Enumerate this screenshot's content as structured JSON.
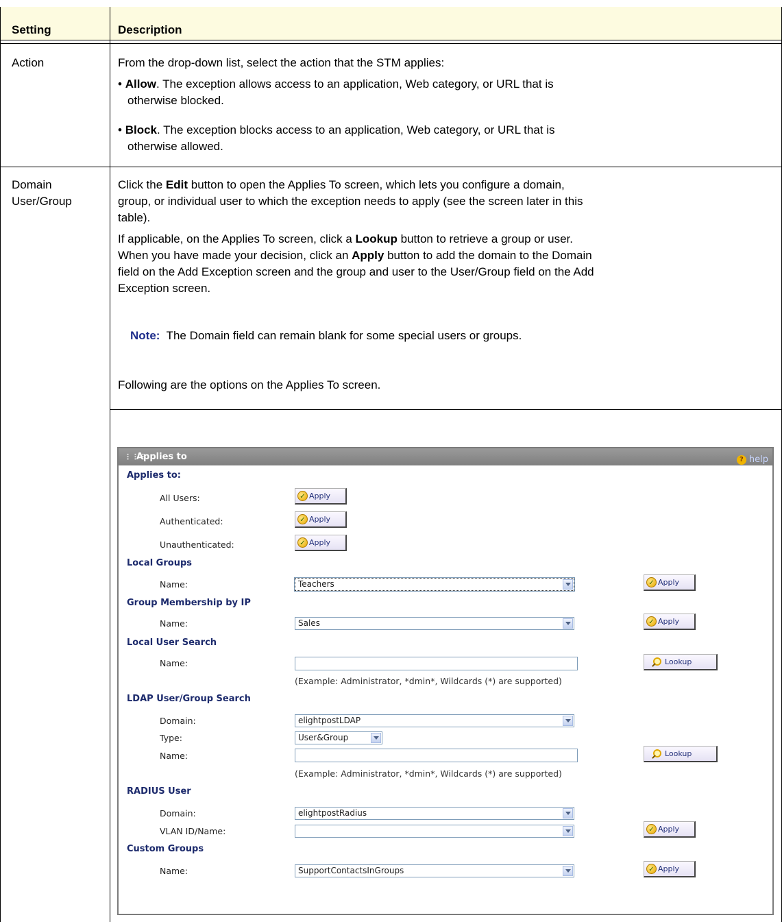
{
  "table": {
    "headers": {
      "setting": "Setting",
      "description": "Description"
    },
    "rows": [
      {
        "setting": "Action",
        "intro": "From the drop-down list, select the action that the STM applies:",
        "bullets": [
          {
            "term": "Allow",
            "text_line1": ". The exception allows access to an application, Web category, or URL that is",
            "text_line2": "otherwise blocked."
          },
          {
            "term": "Block",
            "text_line1": ". The exception blocks access to an application, Web category, or URL that is",
            "text_line2": "otherwise allowed."
          }
        ]
      },
      {
        "setting_line1": "Domain",
        "setting_line2": "User/Group",
        "p1_a": "Click the ",
        "p1_b": "Edit",
        "p1_c": " button to open the Applies To screen, which lets you configure a domain,",
        "p1_l2": "group, or individual user to which the exception needs to apply (see the screen later in this",
        "p1_l3": "table).",
        "p2_a": "If applicable, on the Applies To screen, click a ",
        "p2_b": "Lookup",
        "p2_c": " button to retrieve a group or user.",
        "p2_l2a": "When you have made your decision, click an ",
        "p2_l2b": "Apply",
        "p2_l2c": " button to add the domain to the Domain",
        "p2_l3": "field on the Add Exception screen and the group and user to the User/Group field on the Add",
        "p2_l4": "Exception screen.",
        "note_label": "Note:",
        "note_text": "The Domain field can remain blank for some special users or groups.",
        "p3": "Following are the options on the Applies To screen."
      }
    ]
  },
  "panel": {
    "title": "Applies to",
    "help": "help",
    "apply_label": "Apply",
    "lookup_label": "Lookup",
    "example_text": "(Example: Administrator, *dmin*, Wildcards (*) are supported)",
    "sections": {
      "applies_to": "Applies to:",
      "all_users": "All Users:",
      "authenticated": "Authenticated:",
      "unauthenticated": "Unauthenticated:",
      "local_groups": "Local Groups",
      "local_groups_name": "Name:",
      "local_groups_value": "Teachers",
      "group_ip": "Group Membership by IP",
      "group_ip_name": "Name:",
      "group_ip_value": "Sales",
      "local_user_search": "Local User Search",
      "local_user_name": "Name:",
      "ldap": "LDAP User/Group Search",
      "ldap_domain": "Domain:",
      "ldap_domain_value": "elightpostLDAP",
      "ldap_type": "Type:",
      "ldap_type_value": "User&Group",
      "ldap_name": "Name:",
      "radius": "RADIUS User",
      "radius_domain": "Domain:",
      "radius_domain_value": "elightpostRadius",
      "radius_vlan": "VLAN ID/Name:",
      "custom_groups": "Custom Groups",
      "custom_name": "Name:",
      "custom_value": "SupportContactsInGroups"
    }
  }
}
